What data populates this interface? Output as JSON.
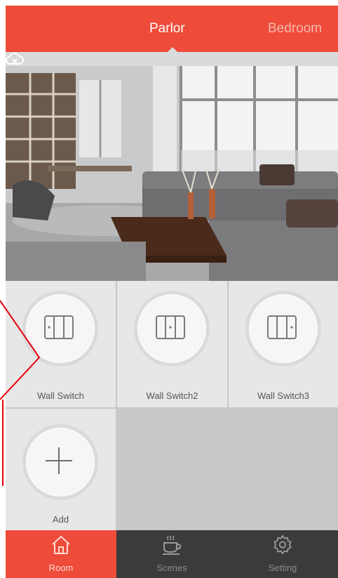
{
  "header": {
    "tabs": [
      {
        "label": "Parlor",
        "active": true
      },
      {
        "label": "Bedroom",
        "active": false
      }
    ]
  },
  "photo": {
    "alt": "Living room photo",
    "cloud_icon": "cloud-offline-icon"
  },
  "devices": [
    {
      "label": "Wall Switch",
      "icon": "wall-switch-icon"
    },
    {
      "label": "Wall Switch2",
      "icon": "wall-switch-icon"
    },
    {
      "label": "Wall Switch3",
      "icon": "wall-switch-icon"
    },
    {
      "label": "Add",
      "icon": "plus-icon"
    }
  ],
  "nav": {
    "items": [
      {
        "label": "Room",
        "icon": "home-icon",
        "active": true
      },
      {
        "label": "Scenes",
        "icon": "coffee-cup-icon",
        "active": false
      },
      {
        "label": "Setting",
        "icon": "gear-icon",
        "active": false
      }
    ]
  },
  "colors": {
    "accent": "#ee4b3a",
    "nav_background": "#3b3b3b",
    "annotation": "#e8000b"
  }
}
